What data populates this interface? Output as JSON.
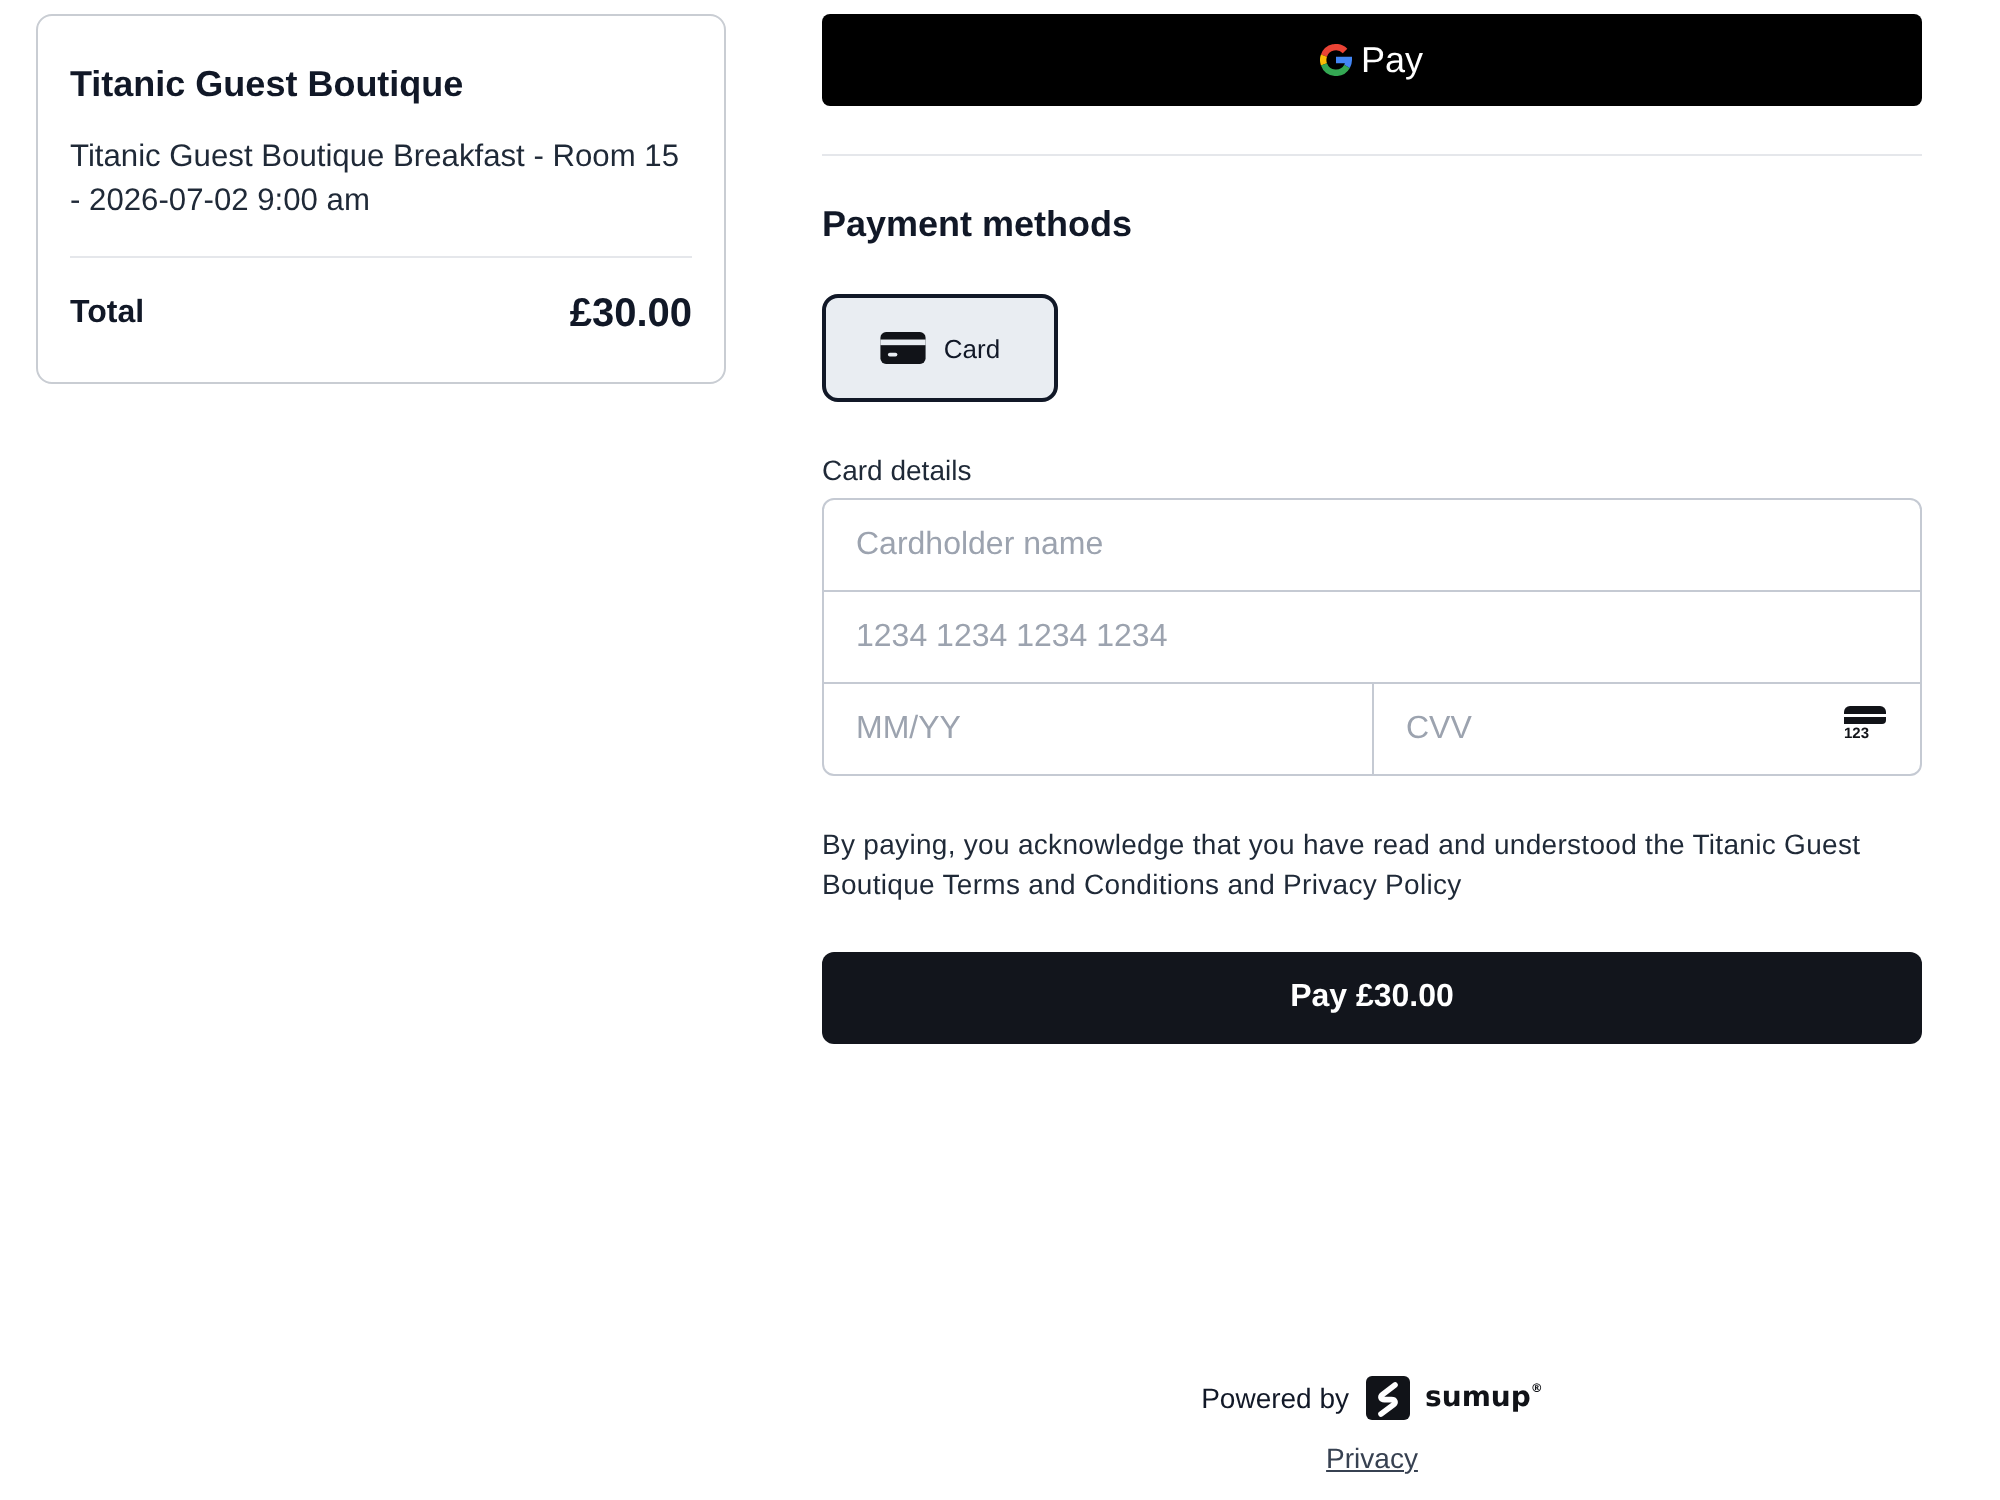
{
  "order_summary": {
    "merchant": "Titanic Guest Boutique",
    "description": "Titanic Guest Boutique Breakfast - Room 15 - 2026-07-02 9:00 am",
    "total_label": "Total",
    "total_amount": "£30.00"
  },
  "google_pay_button": {
    "label": "Pay"
  },
  "payment_methods": {
    "title": "Payment methods",
    "options": [
      {
        "label": "Card",
        "selected": true
      }
    ]
  },
  "card_details": {
    "label": "Card details",
    "cardholder_name": {
      "placeholder": "Cardholder name"
    },
    "card_number": {
      "placeholder": "1234 1234 1234 1234"
    },
    "expiry": {
      "placeholder": "MM/YY"
    },
    "cvv": {
      "placeholder": "CVV",
      "icon_text": "123"
    }
  },
  "consent_text": "By paying, you acknowledge that you have read and understood the Titanic Guest Boutique Terms and Conditions and Privacy Policy",
  "pay_button": {
    "label": "Pay £30.00"
  },
  "footer": {
    "powered_by": "Powered by",
    "brand": "sumup$^{®}$",
    "privacy_link": "Privacy"
  }
}
